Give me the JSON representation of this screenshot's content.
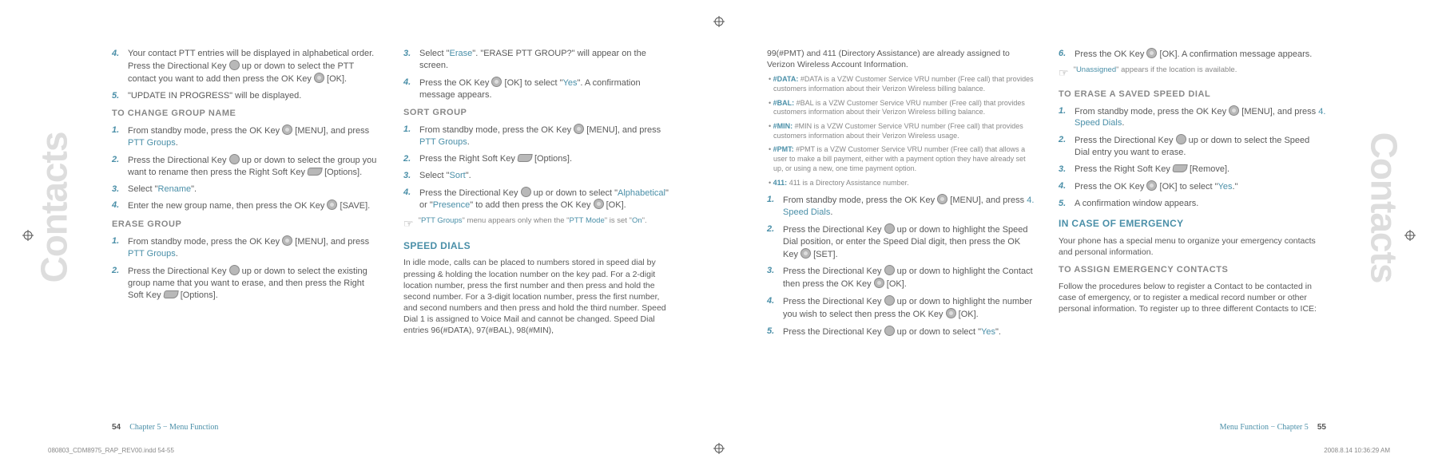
{
  "tabs": {
    "left": "Contacts",
    "right": "Contacts"
  },
  "leftPage": {
    "col1": {
      "items4": {
        "num": "4.",
        "text_a": "Your contact PTT entries will be displayed in alphabetical order. Press the Directional Key ",
        "text_b": " up or down to select the PTT contact you want to add then press the OK Key ",
        "text_c": " [OK]."
      },
      "items5": {
        "num": "5.",
        "text": "\"UPDATE IN PROGRESS\" will be displayed."
      },
      "h_change": "TO CHANGE GROUP NAME",
      "cg1": {
        "num": "1.",
        "text_a": "From standby mode, press the OK Key ",
        "text_b": " [MENU], and press ",
        "link": "PTT Groups",
        "text_c": "."
      },
      "cg2": {
        "num": "2.",
        "text_a": "Press the Directional Key ",
        "text_b": " up or down to select the group you want to rename then press the Right Soft Key ",
        "text_c": " [Options]."
      },
      "cg3": {
        "num": "3.",
        "text_a": "Select \"",
        "link": "Rename",
        "text_b": "\"."
      },
      "cg4": {
        "num": "4.",
        "text_a": "Enter the new group name, then press the OK Key ",
        "text_b": " [SAVE]."
      },
      "h_erase": "ERASE GROUP",
      "eg1": {
        "num": "1.",
        "text_a": "From standby mode, press the OK Key ",
        "text_b": " [MENU], and press ",
        "link": "PTT Groups",
        "text_c": "."
      },
      "eg2": {
        "num": "2.",
        "text_a": "Press the Directional Key ",
        "text_b": " up or down to select the existing group name that you want to erase, and then press the Right Soft Key ",
        "text_c": " [Options]."
      }
    },
    "col2": {
      "eg3": {
        "num": "3.",
        "text_a": "Select \"",
        "link": "Erase",
        "text_b": "\". \"ERASE PTT GROUP?\" will appear on the screen."
      },
      "eg4": {
        "num": "4.",
        "text_a": "Press the OK Key ",
        "text_b": " [OK] to select \"",
        "link": "Yes",
        "text_c": "\". A confirmation message appears."
      },
      "h_sort": "SORT GROUP",
      "sg1": {
        "num": "1.",
        "text_a": "From standby mode, press the OK Key ",
        "text_b": " [MENU], and press ",
        "link": "PTT Groups",
        "text_c": "."
      },
      "sg2": {
        "num": "2.",
        "text_a": "Press the Right Soft Key ",
        "text_b": " [Options]."
      },
      "sg3": {
        "num": "3.",
        "text_a": "Select \"",
        "link": "Sort",
        "text_b": "\"."
      },
      "sg4": {
        "num": "4.",
        "text_a": "Press the Directional Key ",
        "text_b": " up or down to select \"",
        "link1": "Alphabetical",
        "text_c": "\" or \"",
        "link2": "Presence",
        "text_d": "\" to add then press the OK Key ",
        "text_e": " [OK]."
      },
      "note": {
        "a": "\"",
        "l1": "PTT Groups",
        "b": "\" menu appears only when the \"",
        "l2": "PTT Mode",
        "c": "\" is set \"",
        "l3": "On",
        "d": "\"."
      },
      "h_speed": "SPEED DIALS",
      "speed_intro": "In idle mode, calls can be placed to numbers stored in speed dial by pressing & holding the location number on the key pad. For a 2-digit location number, press the first number and then press and hold the second number. For a 3-digit location number, press the first number, and second numbers and then press and hold the third number. Speed Dial 1 is assigned to Voice Mail and cannot be changed. Speed Dial entries 96(#DATA), 97(#BAL), 98(#MIN),"
    },
    "footer": {
      "page": "54",
      "chapter": "Chapter 5 − Menu Function"
    }
  },
  "rightPage": {
    "col1": {
      "cont": "99(#PMT) and 411 (Directory Assistance) are already assigned to Verizon Wireless Account Information.",
      "fine": [
        {
          "b": "#DATA:",
          "t": " #DATA is a VZW Customer Service VRU number (Free call) that provides customers information about their Verizon Wireless billing balance."
        },
        {
          "b": "#BAL:",
          "t": " #BAL is a VZW Customer Service VRU number (Free call) that provides customers information about their Verizon Wireless billing balance."
        },
        {
          "b": "#MIN:",
          "t": " #MIN is a VZW Customer Service VRU number (Free call) that provides customers information about their Verizon Wireless usage."
        },
        {
          "b": "#PMT:",
          "t": " #PMT is a VZW Customer Service VRU number (Free call) that allows a user to make a bill payment, either with a payment option they have already set up, or using a new, one time payment option."
        },
        {
          "b": "411:",
          "t": " 411 is a Directory Assistance number."
        }
      ],
      "sd1": {
        "num": "1.",
        "text_a": "From standby mode, press the OK Key ",
        "text_b": " [MENU], and press ",
        "link": "4. Speed Dials",
        "text_c": "."
      },
      "sd2": {
        "num": "2.",
        "text_a": "Press the Directional Key ",
        "text_b": " up or down to highlight the Speed Dial position, or enter the Speed Dial digit, then press the OK Key ",
        "text_c": " [SET]."
      },
      "sd3": {
        "num": "3.",
        "text_a": "Press the Directional Key ",
        "text_b": " up or down to highlight the Contact then press the OK Key ",
        "text_c": " [OK]."
      },
      "sd4": {
        "num": "4.",
        "text_a": "Press the Directional Key ",
        "text_b": " up or down to highlight the number you wish to select then press the OK Key ",
        "text_c": " [OK]."
      },
      "sd5": {
        "num": "5.",
        "text_a": "Press the Directional Key ",
        "text_b": " up or down to select \"",
        "link": "Yes",
        "text_c": "\"."
      }
    },
    "col2": {
      "sd6": {
        "num": "6.",
        "text_a": "Press the OK Key ",
        "text_b": " [OK]. A confirmation message appears."
      },
      "note": {
        "a": "\"",
        "l1": "Unassigned",
        "b": "\" appears if the location is available."
      },
      "h_erase_sd": "TO ERASE A SAVED SPEED DIAL",
      "es1": {
        "num": "1.",
        "text_a": "From standby mode, press the OK Key ",
        "text_b": " [MENU], and press ",
        "link": "4. Speed Dials",
        "text_c": "."
      },
      "es2": {
        "num": "2.",
        "text_a": "Press the Directional Key ",
        "text_b": " up or down to select the Speed Dial entry you want to erase."
      },
      "es3": {
        "num": "3.",
        "text_a": "Press the Right Soft Key ",
        "text_b": " [Remove]."
      },
      "es4": {
        "num": "4.",
        "text_a": "Press the OK Key ",
        "text_b": " [OK] to select \"",
        "link": "Yes",
        "text_c": ".\""
      },
      "es5": {
        "num": "5.",
        "text": "A confirmation window appears."
      },
      "h_ice": "IN CASE OF EMERGENCY",
      "ice_intro": "Your phone has a special menu to organize your emergency contacts and personal information.",
      "h_assign": "TO ASSIGN EMERGENCY CONTACTS",
      "assign_intro": "Follow the procedures below to register a Contact to be contacted in case of emergency, or to register a medical record number or other personal information. To register up to three different Contacts to ICE:"
    },
    "footer": {
      "chapter": "Menu Function − Chapter 5",
      "page": "55"
    }
  },
  "printline": {
    "left": "080803_CDM8975_RAP_REV00.indd   54-55",
    "right": "2008.8.14   10:36:29 AM"
  }
}
